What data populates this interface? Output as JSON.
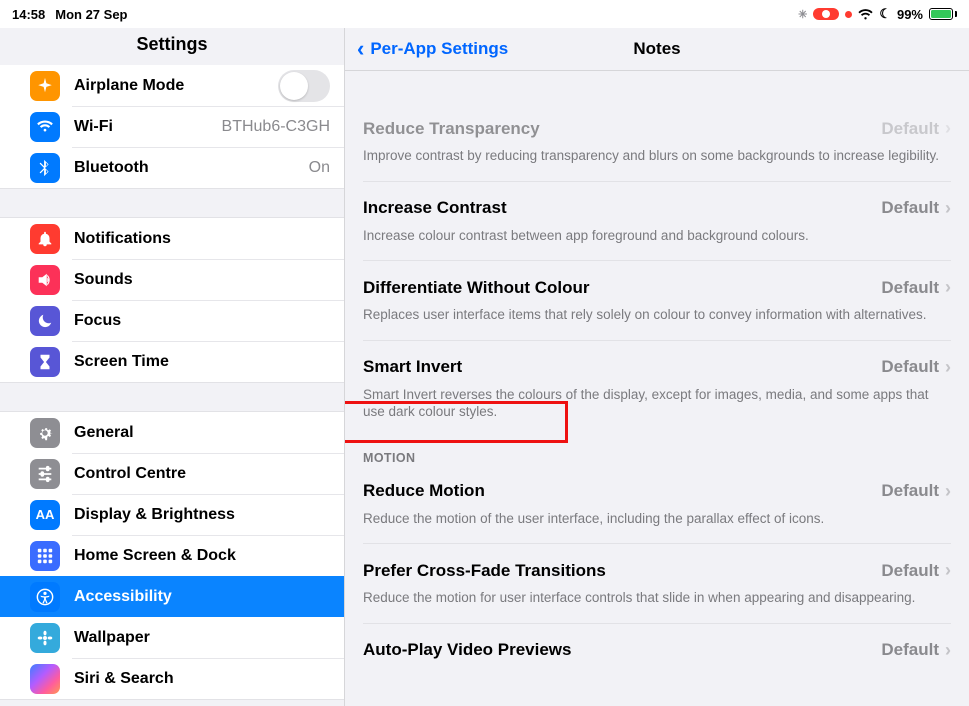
{
  "status": {
    "time": "14:58",
    "date": "Mon 27 Sep",
    "battery_pct": "99%"
  },
  "sidebar": {
    "title": "Settings",
    "airplane": "Airplane Mode",
    "wifi": "Wi-Fi",
    "wifi_value": "BTHub6-C3GH",
    "bluetooth": "Bluetooth",
    "bluetooth_value": "On",
    "notifications": "Notifications",
    "sounds": "Sounds",
    "focus": "Focus",
    "screentime": "Screen Time",
    "general": "General",
    "control_centre": "Control Centre",
    "display": "Display & Brightness",
    "home_dock": "Home Screen & Dock",
    "accessibility": "Accessibility",
    "wallpaper": "Wallpaper",
    "siri": "Siri & Search"
  },
  "main": {
    "back_label": "Per-App Settings",
    "title": "Notes",
    "items": [
      {
        "label": "Reduce Transparency",
        "value": "Default",
        "desc": "Improve contrast by reducing transparency and blurs on some backgrounds to increase legibility."
      },
      {
        "label": "Increase Contrast",
        "value": "Default",
        "desc": "Increase colour contrast between app foreground and background colours."
      },
      {
        "label": "Differentiate Without Colour",
        "value": "Default",
        "desc": "Replaces user interface items that rely solely on colour to convey information with alternatives."
      },
      {
        "label": "Smart Invert",
        "value": "Default",
        "desc": "Smart Invert reverses the colours of the display, except for images, media, and some apps that use dark colour styles."
      }
    ],
    "motion_header": "MOTION",
    "motion_items": [
      {
        "label": "Reduce Motion",
        "value": "Default",
        "desc": "Reduce the motion of the user interface, including the parallax effect of icons."
      },
      {
        "label": "Prefer Cross-Fade Transitions",
        "value": "Default",
        "desc": "Reduce the motion for user interface controls that slide in when appearing and disappearing."
      },
      {
        "label": "Auto-Play Video Previews",
        "value": "Default",
        "desc": ""
      }
    ]
  }
}
